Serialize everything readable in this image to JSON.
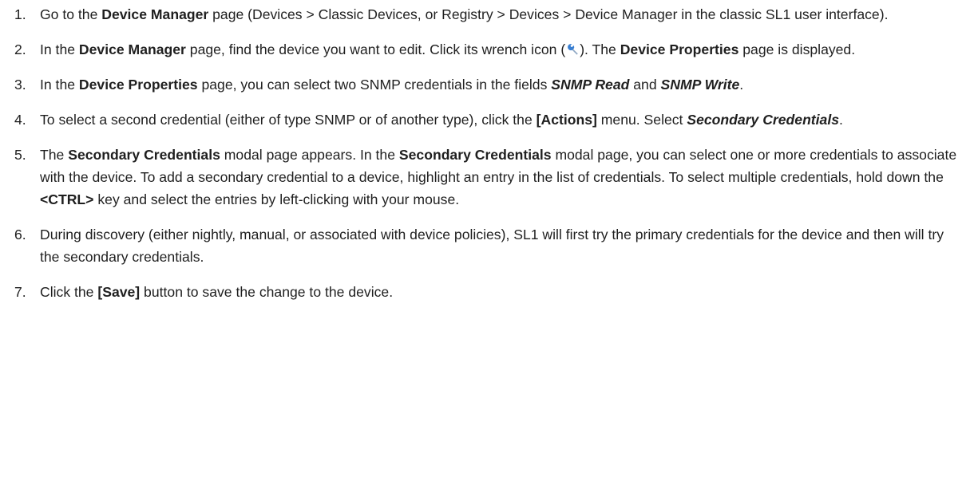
{
  "steps": [
    {
      "num": "1.",
      "parts": [
        {
          "t": "Go to the "
        },
        {
          "t": "Device Manager",
          "s": "b"
        },
        {
          "t": " page (Devices > Classic Devices, or Registry > Devices > Device Manager in the classic SL1 user interface)."
        }
      ]
    },
    {
      "num": "2.",
      "parts": [
        {
          "t": "In the "
        },
        {
          "t": "Device Manager",
          "s": "b"
        },
        {
          "t": " page, find the device you want to edit. Click its wrench icon ("
        },
        {
          "icon": "wrench-icon"
        },
        {
          "t": "). The "
        },
        {
          "t": "Device Properties",
          "s": "b"
        },
        {
          "t": " page is displayed."
        }
      ]
    },
    {
      "num": "3.",
      "parts": [
        {
          "t": "In the "
        },
        {
          "t": "Device Properties",
          "s": "b"
        },
        {
          "t": " page, you can select two SNMP credentials in the fields "
        },
        {
          "t": "SNMP Read",
          "s": "bi"
        },
        {
          "t": " and "
        },
        {
          "t": "SNMP Write",
          "s": "bi"
        },
        {
          "t": "."
        }
      ]
    },
    {
      "num": "4.",
      "parts": [
        {
          "t": "To select a second credential (either of type SNMP or of another type), click the "
        },
        {
          "t": "[Actions]",
          "s": "b"
        },
        {
          "t": " menu. Select "
        },
        {
          "t": "Secondary Credentials",
          "s": "bi"
        },
        {
          "t": "."
        }
      ]
    },
    {
      "num": "5.",
      "parts": [
        {
          "t": "The "
        },
        {
          "t": "Secondary Credentials",
          "s": "b"
        },
        {
          "t": " modal page appears. In the "
        },
        {
          "t": "Secondary Credentials",
          "s": "b"
        },
        {
          "t": " modal page, you can select one or more credentials to associate with the device. To add a secondary credential to a device, highlight an entry in the list of credentials. To select multiple credentials, hold down the "
        },
        {
          "t": "<CTRL>",
          "s": "b"
        },
        {
          "t": " key and select the entries by left-clicking with your mouse."
        }
      ]
    },
    {
      "num": "6.",
      "parts": [
        {
          "t": "During discovery (either nightly, manual, or associated with device policies), SL1 will first try the primary credentials for the device and then will try the secondary credentials."
        }
      ]
    },
    {
      "num": "7.",
      "parts": [
        {
          "t": "Click the "
        },
        {
          "t": "[Save]",
          "s": "b"
        },
        {
          "t": " button to save the change to the device."
        }
      ]
    }
  ],
  "colors": {
    "text": "#1f1f1f",
    "wrench_head": "#3a7fd1",
    "wrench_handle": "#8fa8c4"
  }
}
